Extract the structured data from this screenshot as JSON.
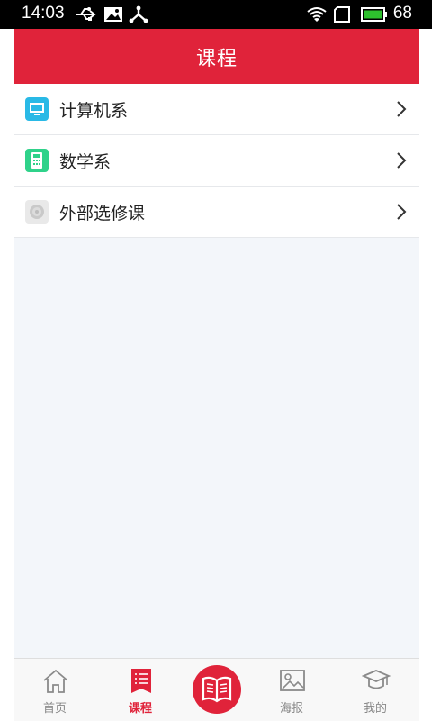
{
  "status_bar": {
    "time": "14:03",
    "battery_level": "68",
    "icons": [
      "usb-icon",
      "image-icon",
      "share-icon",
      "wifi-icon",
      "sim-icon",
      "battery-icon"
    ]
  },
  "header": {
    "title": "课程"
  },
  "departments": [
    {
      "label": "计算机系",
      "icon": "computer-icon",
      "color": "#29b9e6"
    },
    {
      "label": "数学系",
      "icon": "calculator-icon",
      "color": "#2fd28a"
    },
    {
      "label": "外部选修课",
      "icon": "elective-icon",
      "color": "#cfcfcf"
    }
  ],
  "tabs": [
    {
      "label": "首页",
      "icon": "home-icon",
      "active": false
    },
    {
      "label": "课程",
      "icon": "course-list-icon",
      "active": true
    },
    {
      "label": "",
      "icon": "book-icon",
      "active": false
    },
    {
      "label": "海报",
      "icon": "poster-icon",
      "active": false
    },
    {
      "label": "我的",
      "icon": "graduation-cap-icon",
      "active": false
    }
  ],
  "colors": {
    "accent": "#e0233a",
    "background": "#f3f6fa"
  }
}
